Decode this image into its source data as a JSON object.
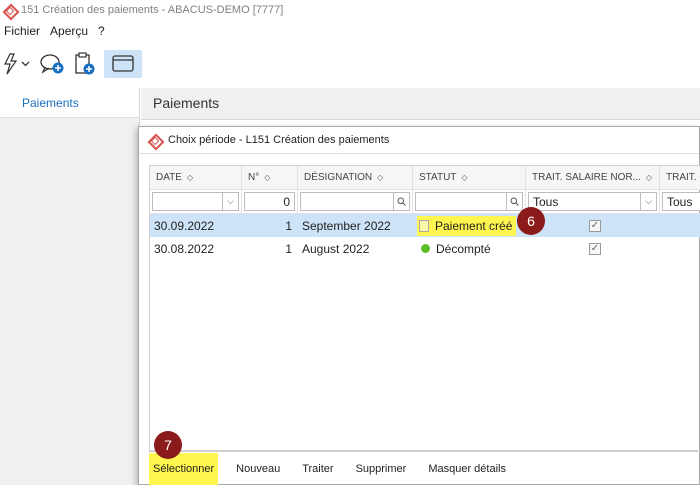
{
  "window": {
    "title": "151 Création des paiements - ABACUS-DEMO [7777]"
  },
  "menu": [
    {
      "label": "Fichier"
    },
    {
      "label": "Aperçu"
    },
    {
      "label": "?"
    }
  ],
  "sidebar": {
    "items": [
      {
        "label": "Paiements"
      }
    ]
  },
  "content": {
    "title": "Paiements"
  },
  "dialog": {
    "title": "Choix période - L151 Création des paiements",
    "columns": [
      {
        "label": "DATE"
      },
      {
        "label": "N°"
      },
      {
        "label": "DÉSIGNATION"
      },
      {
        "label": "STATUT"
      },
      {
        "label": "TRAIT. SALAIRE NOR..."
      },
      {
        "label": "TRAIT. C"
      }
    ],
    "filters": {
      "date": "",
      "number": "0",
      "designation": "",
      "status": "",
      "trait_salaire": "Tous",
      "trait_c": "Tous"
    },
    "rows": [
      {
        "date": "30.09.2022",
        "number": "1",
        "designation": "September 2022",
        "status": "Paiement créé",
        "status_color": "#fff7a8",
        "checked": true
      },
      {
        "date": "30.08.2022",
        "number": "1",
        "designation": "August 2022",
        "status": "Décompté",
        "status_color": "#5cbf2a",
        "checked": true
      }
    ],
    "footer": {
      "select": "Sélectionner",
      "new": "Nouveau",
      "process": "Traiter",
      "delete": "Supprimer",
      "hide_details": "Masquer détails"
    }
  },
  "annotations": {
    "step6": "6",
    "step7": "7"
  },
  "colors": {
    "accent": "#1a6fc0",
    "highlight": "#fff64f",
    "badge": "#8b1a1a",
    "selection": "#cde3f7"
  }
}
